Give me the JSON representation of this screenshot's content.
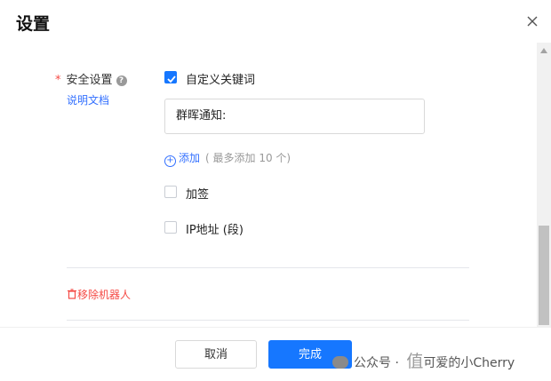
{
  "dialog": {
    "title": "设置"
  },
  "security": {
    "required_mark": "*",
    "label": "安全设置",
    "help_glyph": "?",
    "doc_link": "说明文档",
    "custom_keyword": {
      "label": "自定义关键词",
      "checked": true
    },
    "keyword_value": "群晖通知:",
    "add_glyph": "+",
    "add_label": "添加",
    "add_hint": "( 最多添加 10 个)",
    "sign": {
      "label": "加签",
      "checked": false
    },
    "ip": {
      "label": "IP地址 (段)",
      "checked": false
    }
  },
  "remove": {
    "label": "移除机器人"
  },
  "footer": {
    "cancel_label": "取消",
    "done_label": "完成"
  },
  "watermark": {
    "prefix": "公众号 · ",
    "brand": "值",
    "text": "可爱的小Cherry"
  },
  "colors": {
    "accent": "#1677ff",
    "link": "#3370ff",
    "danger": "#f54a45"
  }
}
